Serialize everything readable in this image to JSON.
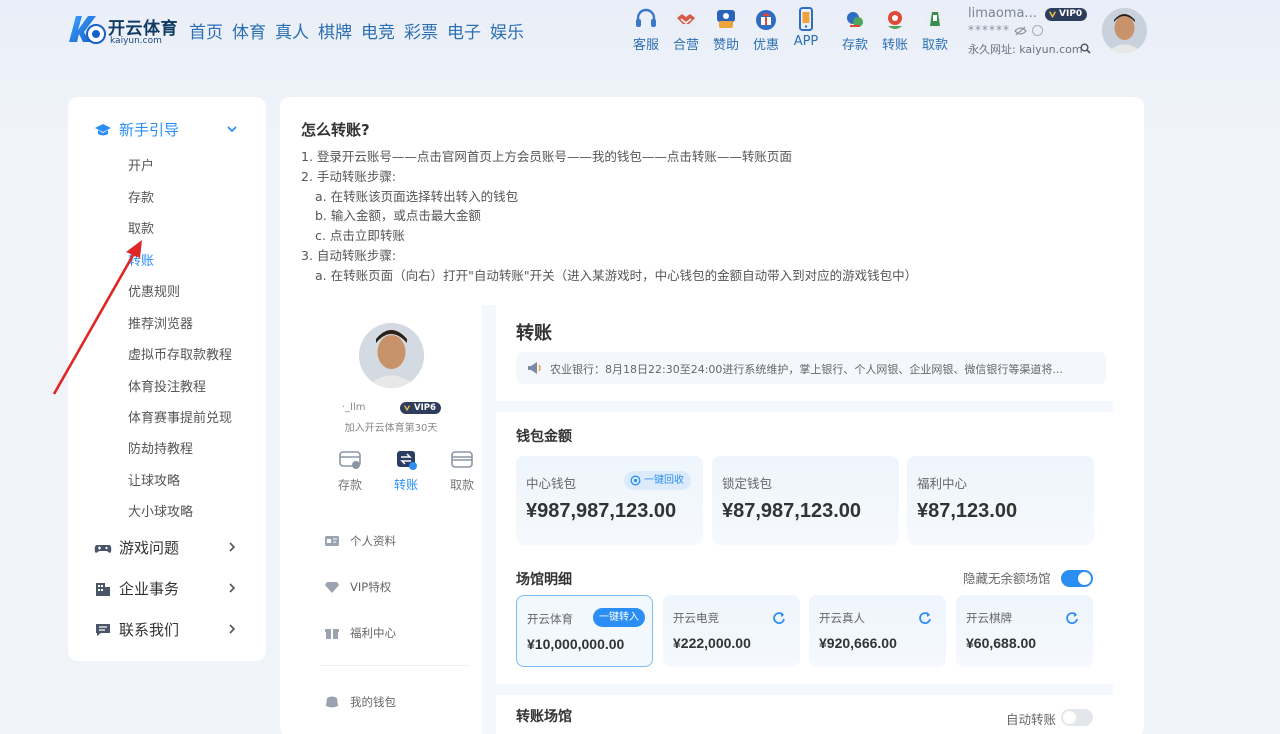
{
  "brand": {
    "name": "开云体育",
    "sub": "kaiyun.com"
  },
  "main_nav": [
    "首页",
    "体育",
    "真人",
    "棋牌",
    "电竞",
    "彩票",
    "电子",
    "娱乐"
  ],
  "quick_nav": [
    {
      "label": "客服",
      "icon": "headset-icon"
    },
    {
      "label": "合营",
      "icon": "handshake-icon"
    },
    {
      "label": "赞助",
      "icon": "sponsor-badge-icon"
    },
    {
      "label": "优惠",
      "icon": "gift-icon"
    },
    {
      "label": "APP",
      "icon": "phone-icon"
    },
    {
      "label": "存款",
      "icon": "deposit-icon"
    },
    {
      "label": "转账",
      "icon": "transfer-icon"
    },
    {
      "label": "取款",
      "icon": "withdraw-icon"
    }
  ],
  "user": {
    "name": "limaoma...",
    "vip": "VIP0",
    "password": "******",
    "url_text": "永久网址: kaiyun.com"
  },
  "sidebar": {
    "sections": [
      {
        "title": "新手引导",
        "expanded": true
      },
      {
        "title": "游戏问题",
        "expanded": false
      },
      {
        "title": "企业事务",
        "expanded": false
      },
      {
        "title": "联系我们",
        "expanded": false
      }
    ],
    "items": [
      "开户",
      "存款",
      "取款",
      "转账",
      "优惠规则",
      "推荐浏览器",
      "虚拟币存取款教程",
      "体育投注教程",
      "体育赛事提前兑现",
      "防劫持教程",
      "让球攻略",
      "大小球攻略"
    ],
    "active_item": "转账"
  },
  "article": {
    "title": "怎么转账?",
    "steps": [
      "1. 登录开云账号——点击官网首页上方会员账号——我的钱包——点击转账——转账页面",
      "2. 手动转账步骤:",
      "a. 在转账该页面选择转出转入的钱包",
      "b. 输入金额，或点击最大金额",
      "c. 点击立即转账",
      "3. 自动转账步骤:",
      "a. 在转账页面（向右）打开\"自动转账\"开关（进入某游戏时，中心钱包的金额自动带入到对应的游戏钱包中）"
    ]
  },
  "profile_card": {
    "name": "·_llm",
    "vip": "VIP6",
    "join_text": "加入开云体育第30天",
    "actions": [
      "存款",
      "转账",
      "取款"
    ],
    "menu": [
      "个人资料",
      "VIP特权",
      "福利中心",
      "我的钱包"
    ]
  },
  "transfer": {
    "title": "转账",
    "notice": "农业银行：8月18日22:30至24:00进行系统维护，掌上银行、个人网银、企业网银、微信银行等渠道将...",
    "wallet_section": "钱包金额",
    "wallets": [
      {
        "name": "中心钱包",
        "amount": "¥987,987,123.00",
        "button": "一键回收"
      },
      {
        "name": "锁定钱包",
        "amount": "¥87,987,123.00"
      },
      {
        "name": "福利中心",
        "amount": "¥87,123.00"
      }
    ],
    "venue_section": "场馆明细",
    "hide_empty_label": "隐藏无余额场馆",
    "hide_empty_on": true,
    "venues": [
      {
        "name": "开云体育",
        "amount": "¥10,000,000.00",
        "button": "一键转入",
        "selected": true
      },
      {
        "name": "开云电竞",
        "amount": "¥222,000.00"
      },
      {
        "name": "开云真人",
        "amount": "¥920,666.00"
      },
      {
        "name": "开云棋牌",
        "amount": "¥60,688.00"
      }
    ],
    "transfer_venue_section": "转账场馆",
    "auto_transfer_label": "自动转账",
    "auto_transfer_on": false
  },
  "colors": {
    "accent": "#2b8ef5",
    "nav_text": "#2c6fb3",
    "annotation_arrow": "#e02525"
  }
}
